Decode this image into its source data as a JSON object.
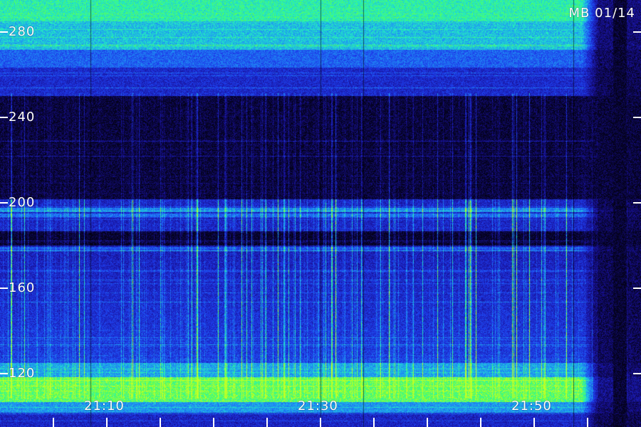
{
  "station_label": "MB 01/14",
  "y_axis": {
    "tick_labels": [
      "280",
      "240",
      "200",
      "160",
      "120"
    ],
    "tick_values": [
      280,
      240,
      200,
      160,
      120
    ],
    "range": [
      110,
      290
    ]
  },
  "x_axis": {
    "tick_labels": [
      "21:10",
      "21:30",
      "21:50"
    ],
    "label_times": [
      "21:10",
      "21:30",
      "21:50"
    ],
    "minor_tick_interval_minutes": 5
  },
  "colors": {
    "background": "#04021a",
    "low": "#1a14a0",
    "mid": "#1e8cf0",
    "high": "#23f5b4",
    "peak": "#b4ff28",
    "tick": "#ffffff"
  }
}
